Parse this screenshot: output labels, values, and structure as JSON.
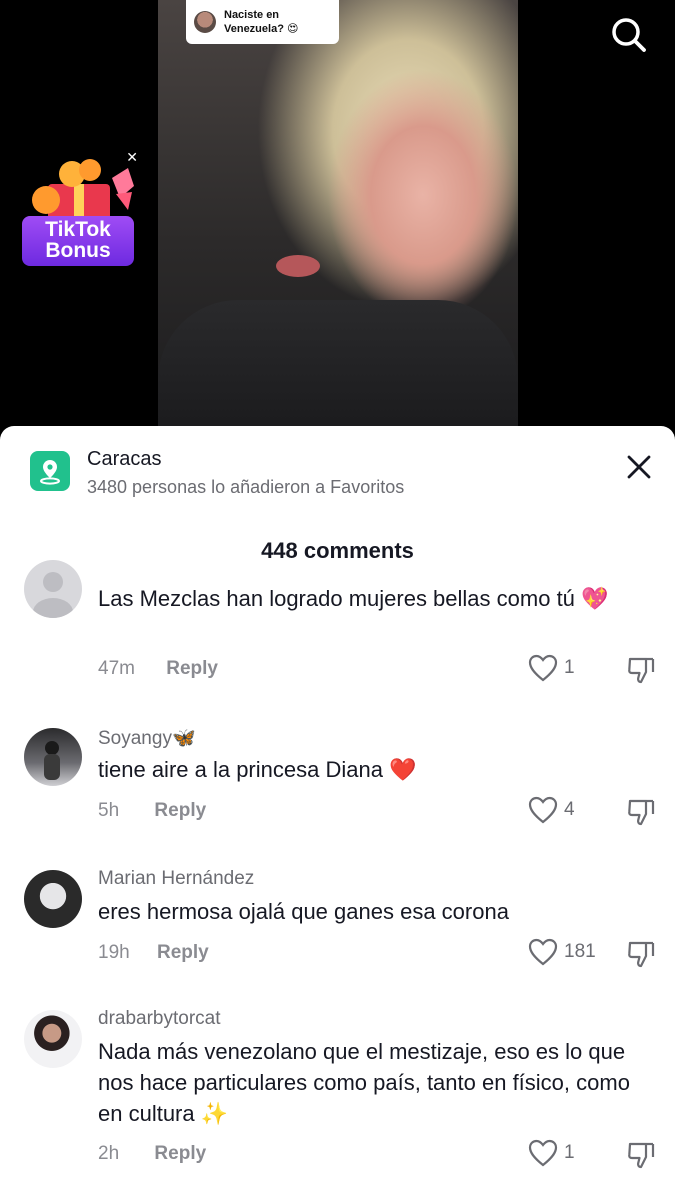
{
  "video": {
    "sticker_question": "Naciste en Venezuela? 😍",
    "bonus_label_line1": "TikTok",
    "bonus_label_line2": "Bonus"
  },
  "sheet": {
    "place_name": "Caracas",
    "place_sub": "3480 personas lo añadieron a Favoritos",
    "comments_title": "448 comments"
  },
  "comments": [
    {
      "user": "",
      "text": "Las Mezclas han logrado mujeres bellas como tú 💖",
      "time": "47m",
      "reply_label": "Reply",
      "likes": "1"
    },
    {
      "user": "Soyangy🦋",
      "text": "tiene aire a la princesa Diana ❤️",
      "time": "5h",
      "reply_label": "Reply",
      "likes": "4"
    },
    {
      "user": "Marian Hernández",
      "text": "eres hermosa ojalá que ganes esa corona",
      "time": "19h",
      "reply_label": "Reply",
      "likes": "181"
    },
    {
      "user": "drabarbytorcat",
      "text": "Nada más venezolano que el mestizaje, eso es lo que nos hace particulares como país, tanto en físico, como en cultura ✨",
      "time": "2h",
      "reply_label": "Reply",
      "likes": "1"
    }
  ],
  "colors": {
    "accent_place": "#21c18d",
    "bonus_purple": "#7b35ea",
    "text_primary": "#161823",
    "text_secondary": "#6b6c72"
  },
  "icons": [
    "search-icon",
    "close-icon",
    "location-pin-icon",
    "heart-icon",
    "dislike-icon",
    "gift-icon"
  ]
}
